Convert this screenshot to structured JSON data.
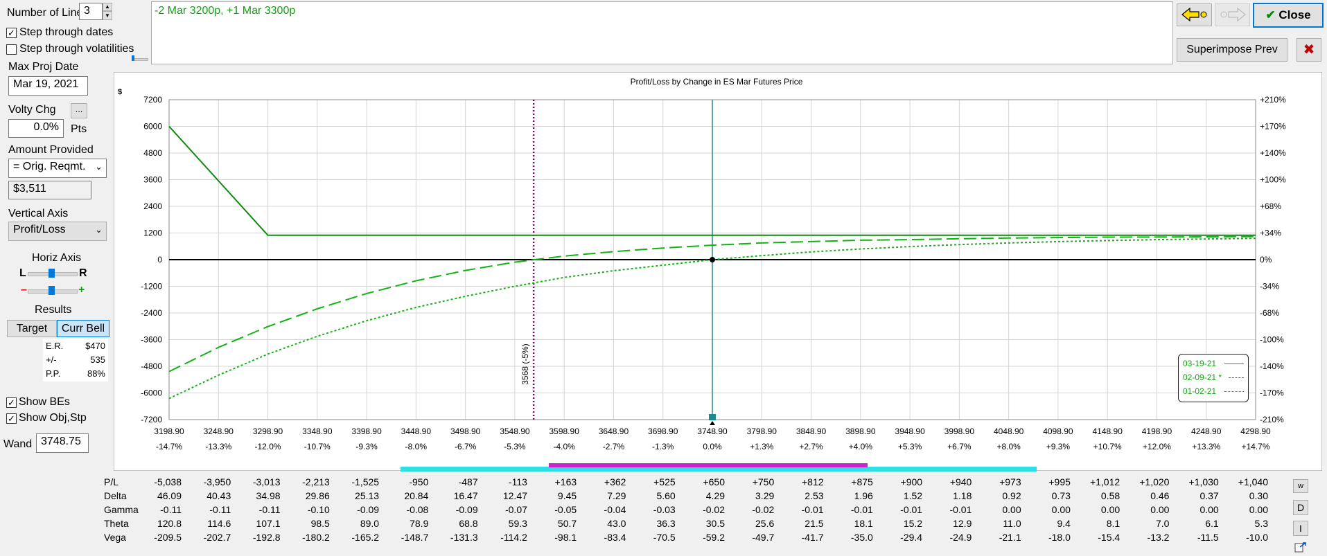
{
  "controls": {
    "num_lines_label": "Number of Lines",
    "num_lines_value": "3",
    "step_dates_label": "Step through dates",
    "step_vols_label": "Step through volatilities",
    "max_proj_date_label": "Max Proj Date",
    "max_proj_date_value": "Mar 19, 2021",
    "volty_chg_label": "Volty Chg",
    "volty_btn": "...",
    "volty_value": "0.0%",
    "pts_label": "Pts",
    "amount_provided_label": "Amount Provided",
    "amount_provided_value": "= Orig. Reqmt.",
    "amount_value": "$3,511",
    "vertical_axis_label": "Vertical Axis",
    "vertical_axis_value": "Profit/Loss",
    "horiz_axis_label": "Horiz Axis",
    "h_left": "L",
    "h_right": "R",
    "h_minus": "–",
    "h_plus": "+",
    "results_label": "Results",
    "target_btn": "Target",
    "curr_bell_btn": "Curr Bell",
    "er_label": "E.R.",
    "er_value": "$470",
    "pm_label": "+/-",
    "pm_value": "535",
    "pp_label": "P.P.",
    "pp_value": "88%",
    "show_bes_label": "Show BEs",
    "show_obj_label": "Show Obj,Stp",
    "wand_label": "Wand",
    "wand_value": "3748.75",
    "position_text": "-2 Mar 3200p, +1 Mar 3300p"
  },
  "toolbar": {
    "close_label": "Close",
    "superimpose_label": "Superimpose Prev",
    "close_x": "✖",
    "check_glyph": "✔"
  },
  "colors": {
    "curve": "#11b311",
    "curve_dark": "#118a11",
    "bar_cyan": "#2ee0e6",
    "bar_magenta": "#cc22cc",
    "dotted_purple": "#800080",
    "cursor_line": "#2a8a8a"
  },
  "chart_data": {
    "type": "line",
    "title": "Profit/Loss by Change in ES Mar Futures Price",
    "ylabel": "$",
    "ylim": [
      -7200,
      7200
    ],
    "y_ticks": [
      "7200",
      "6000",
      "4800",
      "3600",
      "2400",
      "1200",
      "0",
      "-1200",
      "-2400",
      "-3600",
      "-4800",
      "-6000",
      "-7200"
    ],
    "y_ticks_right": [
      "+210%",
      "+170%",
      "+140%",
      "+100%",
      "+68%",
      "+34%",
      "0%",
      "-34%",
      "-68%",
      "-100%",
      "-140%",
      "-170%",
      "-210%"
    ],
    "x_ticks": [
      "3198.90",
      "3248.90",
      "3298.90",
      "3348.90",
      "3398.90",
      "3448.90",
      "3498.90",
      "3548.90",
      "3598.90",
      "3648.90",
      "3698.90",
      "3748.90",
      "3798.90",
      "3848.90",
      "3898.90",
      "3948.90",
      "3998.90",
      "4048.90",
      "4098.90",
      "4148.90",
      "4198.90",
      "4248.90",
      "4298.90"
    ],
    "x_pct": [
      "-14.7%",
      "-13.3%",
      "-12.0%",
      "-10.7%",
      "-9.3%",
      "-8.0%",
      "-6.7%",
      "-5.3%",
      "-4.0%",
      "-2.7%",
      "-1.3%",
      "0.0%",
      "+1.3%",
      "+2.7%",
      "+4.0%",
      "+5.3%",
      "+6.7%",
      "+8.0%",
      "+9.3%",
      "+10.7%",
      "+12.0%",
      "+13.3%",
      "+14.7%"
    ],
    "xlim": [
      3198.9,
      4298.9
    ],
    "series": [
      {
        "name": "03-19-21",
        "style": "solid",
        "x": [
          3198.9,
          3298.9,
          4298.9
        ],
        "y": [
          6000,
          1100,
          1100
        ]
      },
      {
        "name": "02-09-21 *",
        "style": "dashed",
        "x": [
          3198.9,
          3248.9,
          3298.9,
          3348.9,
          3398.9,
          3448.9,
          3498.9,
          3548.9,
          3598.9,
          3648.9,
          3698.9,
          3748.9,
          3798.9,
          3848.9,
          3898.9,
          3948.9,
          3998.9,
          4048.9,
          4098.9,
          4148.9,
          4198.9,
          4248.9,
          4298.9
        ],
        "y": [
          -5038,
          -3950,
          -3013,
          -2213,
          -1525,
          -950,
          -487,
          -113,
          163,
          362,
          525,
          650,
          750,
          812,
          875,
          900,
          940,
          973,
          995,
          1012,
          1020,
          1030,
          1040
        ]
      },
      {
        "name": "01-02-21",
        "style": "dotted",
        "x": [
          3198.9,
          3248.9,
          3298.9,
          3348.9,
          3398.9,
          3448.9,
          3498.9,
          3548.9,
          3598.9,
          3648.9,
          3698.9,
          3748.9,
          3798.9,
          3848.9,
          3898.9,
          3948.9,
          3998.9,
          4048.9,
          4098.9,
          4148.9,
          4198.9,
          4248.9,
          4298.9
        ],
        "y": [
          -6250,
          -5200,
          -4250,
          -3450,
          -2750,
          -2150,
          -1650,
          -1200,
          -800,
          -500,
          -250,
          0,
          180,
          350,
          480,
          590,
          680,
          750,
          810,
          860,
          900,
          930,
          960
        ]
      }
    ],
    "vline_label": "3568 (-5%)",
    "vline_x": 3568,
    "cursor_x": 3748.9,
    "legend_position": "bottom-right"
  },
  "table": {
    "row_labels": [
      "P/L",
      "Delta",
      "Gamma",
      "Theta",
      "Vega"
    ],
    "rows": [
      [
        "-5,038",
        "-3,950",
        "-3,013",
        "-2,213",
        "-1,525",
        "-950",
        "-487",
        "-113",
        "+163",
        "+362",
        "+525",
        "+650",
        "+750",
        "+812",
        "+875",
        "+900",
        "+940",
        "+973",
        "+995",
        "+1,012",
        "+1,020",
        "+1,030",
        "+1,040"
      ],
      [
        "46.09",
        "40.43",
        "34.98",
        "29.86",
        "25.13",
        "20.84",
        "16.47",
        "12.47",
        "9.45",
        "7.29",
        "5.60",
        "4.29",
        "3.29",
        "2.53",
        "1.96",
        "1.52",
        "1.18",
        "0.92",
        "0.73",
        "0.58",
        "0.46",
        "0.37",
        "0.30"
      ],
      [
        "-0.11",
        "-0.11",
        "-0.11",
        "-0.10",
        "-0.09",
        "-0.08",
        "-0.09",
        "-0.07",
        "-0.05",
        "-0.04",
        "-0.03",
        "-0.02",
        "-0.02",
        "-0.01",
        "-0.01",
        "-0.01",
        "-0.01",
        "0.00",
        "0.00",
        "0.00",
        "0.00",
        "0.00",
        "0.00"
      ],
      [
        "120.8",
        "114.6",
        "107.1",
        "98.5",
        "89.0",
        "78.9",
        "68.8",
        "59.3",
        "50.7",
        "43.0",
        "36.3",
        "30.5",
        "25.6",
        "21.5",
        "18.1",
        "15.2",
        "12.9",
        "11.0",
        "9.4",
        "8.1",
        "7.0",
        "6.1",
        "5.3"
      ],
      [
        "-209.5",
        "-202.7",
        "-192.8",
        "-180.2",
        "-165.2",
        "-148.7",
        "-131.3",
        "-114.2",
        "-98.1",
        "-83.4",
        "-70.5",
        "-59.2",
        "-49.7",
        "-41.7",
        "-35.0",
        "-29.4",
        "-24.9",
        "-21.1",
        "-18.0",
        "-15.4",
        "-13.2",
        "-11.5",
        "-10.0"
      ]
    ],
    "side_btn_w": "w",
    "side_btn_d": "D",
    "side_btn_i": "I"
  }
}
